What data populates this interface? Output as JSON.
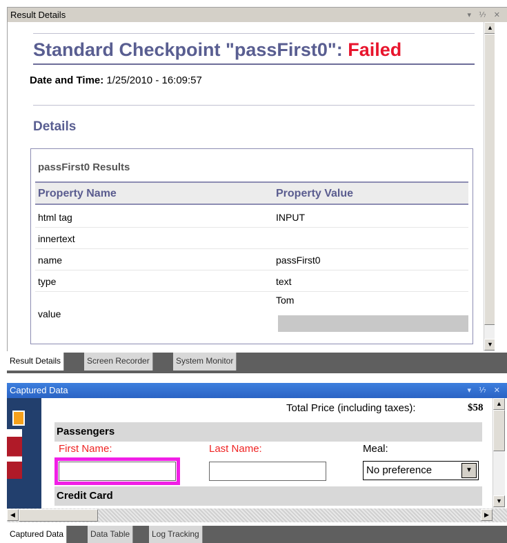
{
  "result_pane": {
    "title": "Result Details",
    "controls": "▾ ⅐ ✕",
    "heading_prefix": "Standard Checkpoint \"passFirst0\": ",
    "heading_status": "Failed",
    "datetime_label": "Date and Time:",
    "datetime_value": " 1/25/2010 - 16:09:57",
    "details_heading": "Details",
    "results_caption": "passFirst0 Results",
    "col_property": "Property Name",
    "col_value": "Property Value",
    "rows": [
      {
        "name": "html tag",
        "value": "INPUT"
      },
      {
        "name": "innertext",
        "value": ""
      },
      {
        "name": "name",
        "value": "passFirst0"
      },
      {
        "name": "type",
        "value": "text"
      },
      {
        "name": "value",
        "value": "Tom"
      }
    ]
  },
  "top_tabs": [
    "Result Details",
    "Screen Recorder",
    "System Monitor"
  ],
  "captured_pane": {
    "title": "Captured Data",
    "controls": "▾ ⅐ ✕",
    "total_label": "Total Price (including taxes):",
    "total_amount": "$58",
    "passengers_heading": "Passengers",
    "first_name_label": "First Name:",
    "last_name_label": "Last Name:",
    "meal_label": "Meal:",
    "meal_value": "No preference",
    "credit_card_heading": "Credit Card",
    "highlight_color": "#f11fe6"
  },
  "bottom_tabs": [
    "Captured Data",
    "Data Table",
    "Log Tracking"
  ]
}
